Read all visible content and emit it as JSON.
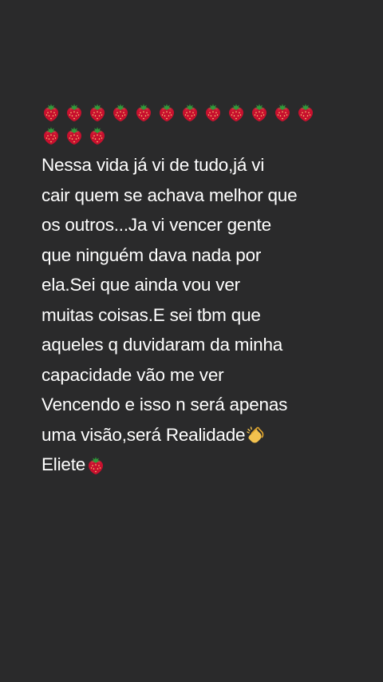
{
  "post": {
    "top_emoji_rows": [
      {
        "icon": "strawberry-icon",
        "count": 12
      },
      {
        "icon": "strawberry-icon",
        "count": 3
      }
    ],
    "lines": [
      "Nessa vida já vi de tudo,já vi",
      "cair quem se achava melhor que",
      "os outros...Ja vi vencer gente",
      "que ninguém dava nada  por",
      "ela.Sei que ainda vou ver",
      "muitas coisas.E sei tbm que",
      "aqueles q duvidaram da minha",
      "capacidade vão me ver",
      "Vencendo e isso n será apenas",
      "uma visão,será Realidade",
      "Eliete"
    ],
    "trailing_icons": {
      "9": "clapping-hands-icon",
      "10": "strawberry-icon"
    }
  },
  "colors": {
    "background": "#2a2a2b",
    "text": "#ffffff",
    "strawberry": "#c8102e"
  }
}
